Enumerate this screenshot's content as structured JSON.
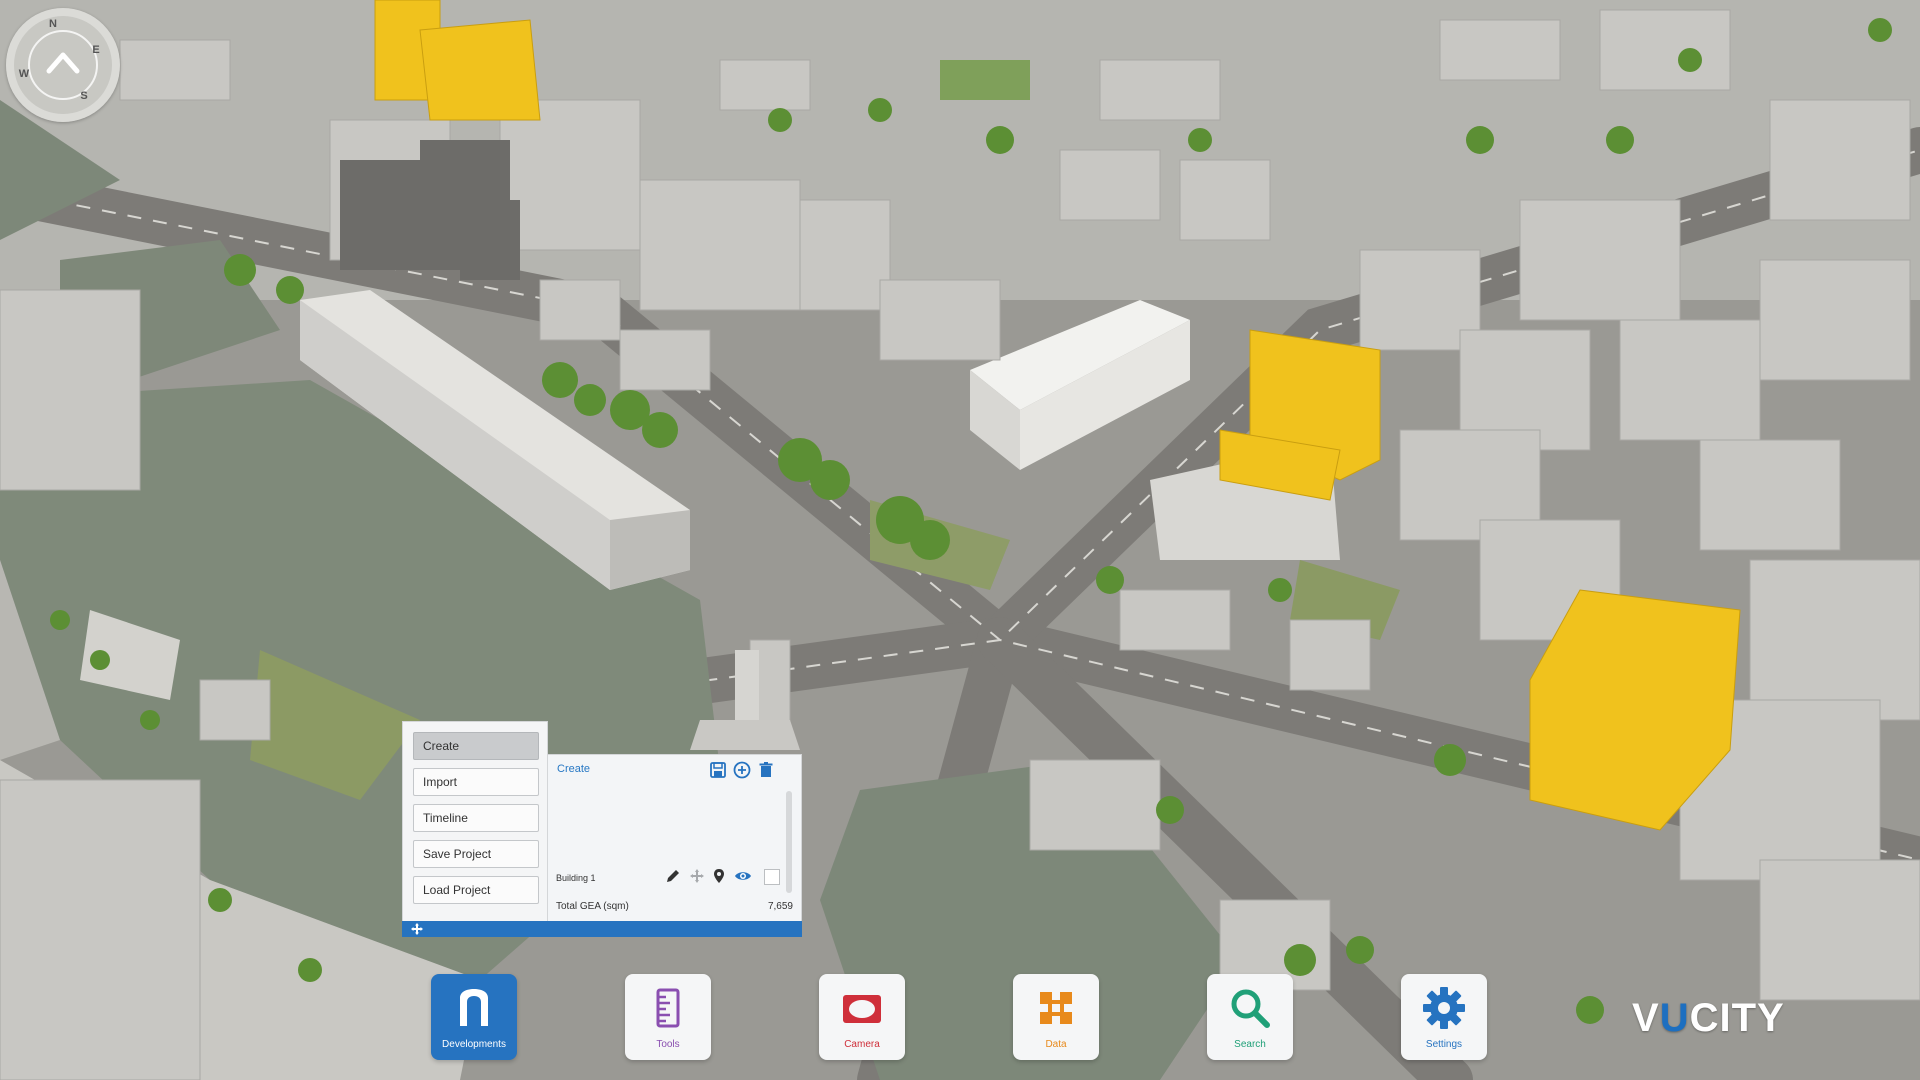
{
  "compass": {
    "north": "N",
    "east": "E",
    "south": "S",
    "west": "W"
  },
  "dev_menu": {
    "items": [
      {
        "label": "Create",
        "active": true
      },
      {
        "label": "Import",
        "active": false
      },
      {
        "label": "Timeline",
        "active": false
      },
      {
        "label": "Save Project",
        "active": false
      },
      {
        "label": "Load Project",
        "active": false
      }
    ]
  },
  "create_panel": {
    "title": "Create",
    "icons": [
      "save-icon",
      "add-circle-icon",
      "trash-icon"
    ],
    "buildings": [
      {
        "name": "Building 1",
        "icons": [
          "pencil-icon",
          "move-icon",
          "location-pin-icon",
          "eye-icon"
        ],
        "checked": false
      }
    ],
    "total_gea_label": "Total GEA (sqm)",
    "total_gea_value": "7,659"
  },
  "toolbar": {
    "items": [
      {
        "label": "Developments",
        "icon": "building-arch-icon",
        "active": true,
        "color": "#ffffff"
      },
      {
        "label": "Tools",
        "icon": "ruler-icon",
        "active": false,
        "color": "#8a4fb0"
      },
      {
        "label": "Camera",
        "icon": "camera-icon",
        "active": false,
        "color": "#cf2f3a"
      },
      {
        "label": "Data",
        "icon": "data-icon",
        "active": false,
        "color": "#e88a1c"
      },
      {
        "label": "Search",
        "icon": "search-icon",
        "active": false,
        "color": "#20a078"
      },
      {
        "label": "Settings",
        "icon": "gear-icon",
        "active": false,
        "color": "#2673c0"
      }
    ]
  },
  "logo": {
    "part1": "V",
    "part2": "U",
    "part3": "CITY"
  },
  "colors": {
    "accent": "#2673c0",
    "highlight_building": "#f0c21d"
  }
}
